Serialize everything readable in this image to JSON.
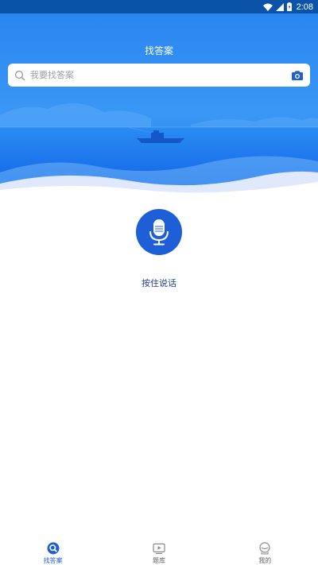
{
  "status_bar": {
    "time": "2:08"
  },
  "header": {
    "title": "找答案"
  },
  "search": {
    "placeholder": "我要找答案"
  },
  "voice": {
    "label": "按住说话"
  },
  "nav": {
    "items": [
      {
        "label": "找答案",
        "icon": "search-tab-icon",
        "active": true
      },
      {
        "label": "题库",
        "icon": "play-box-icon",
        "active": false
      },
      {
        "label": "我的",
        "icon": "profile-icon",
        "active": false
      }
    ]
  },
  "colors": {
    "primary": "#1e5fd8",
    "status_bar": "#0b53a8",
    "hero_top": "#2f8bf2",
    "hero_bottom": "#1160e6"
  }
}
